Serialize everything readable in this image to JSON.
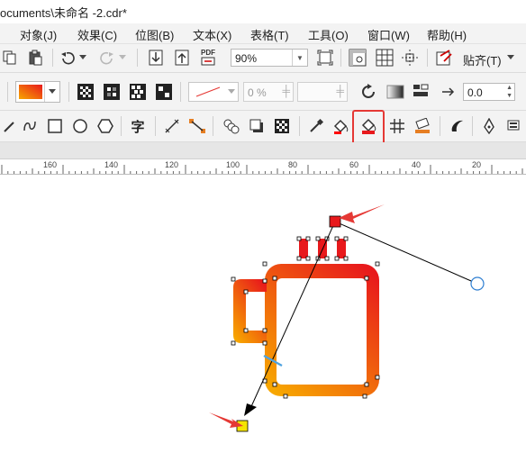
{
  "window": {
    "title": "ocuments\\未命名 -2.cdr*"
  },
  "menu": {
    "items": [
      {
        "label": "对象(J)"
      },
      {
        "label": "效果(C)"
      },
      {
        "label": "位图(B)"
      },
      {
        "label": "文本(X)"
      },
      {
        "label": "表格(T)"
      },
      {
        "label": "工具(O)"
      },
      {
        "label": "窗口(W)"
      },
      {
        "label": "帮助(H)"
      }
    ]
  },
  "toolbar": {
    "zoom_value": "90%",
    "snap_label": "贴齐(T)",
    "pdf_label": "PDF"
  },
  "property_bar": {
    "transparency_value": "0 %",
    "offset_value": "0.0"
  },
  "toolbox": {
    "text_tool_label": "字"
  },
  "ruler": {
    "labels": [
      "160",
      "140",
      "120",
      "100",
      "80",
      "60",
      "40",
      "20"
    ]
  },
  "canvas": {
    "colors": {
      "gradient_start": "#f7a600",
      "gradient_end": "#e8191c",
      "start_node": "#f5e400",
      "end_node": "#e8191c",
      "highlight": "#e53935",
      "midpoint_marker": "#4fa3e0"
    }
  }
}
